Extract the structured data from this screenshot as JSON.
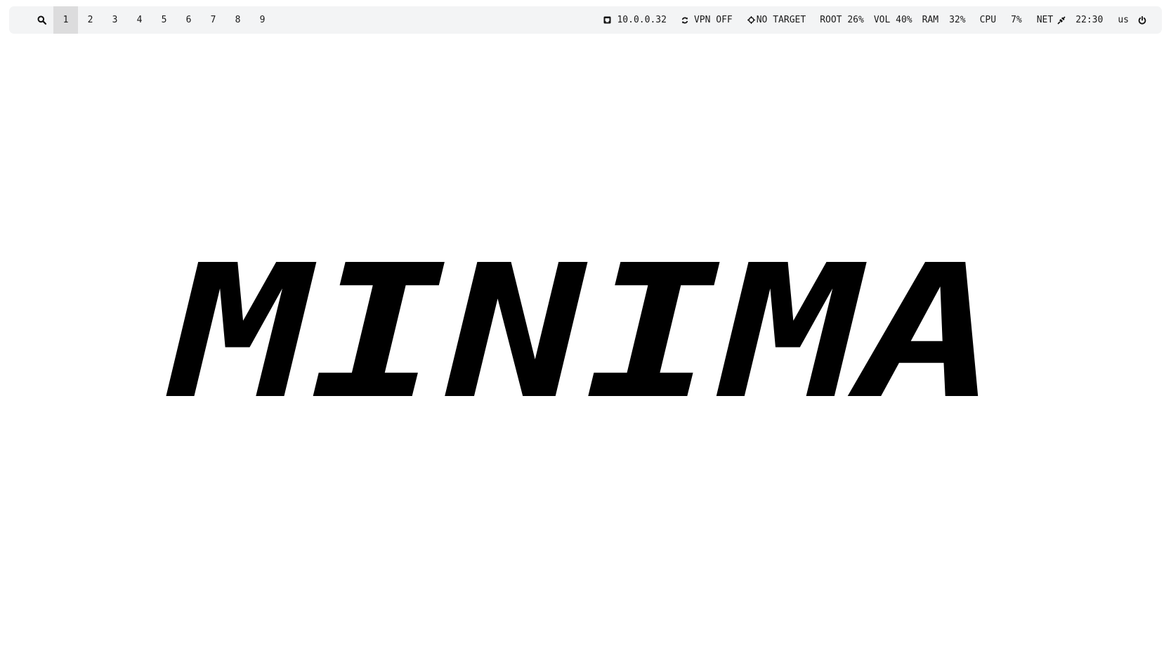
{
  "topbar": {
    "workspaces": [
      "1",
      "2",
      "3",
      "4",
      "5",
      "6",
      "7",
      "8",
      "9"
    ],
    "active_workspace": "1",
    "ip": {
      "icon": "ethernet-icon",
      "text": "10.0.0.32"
    },
    "vpn": {
      "icon": "sync-icon",
      "text": "VPN OFF"
    },
    "target": {
      "icon": "crosshair-icon",
      "text": "NO TARGET"
    },
    "root": "ROOT 26%",
    "vol": "VOL 40%",
    "ram_label": "RAM",
    "ram_value": "32%",
    "cpu_label": "CPU",
    "cpu_value": "7%",
    "net_label": "NET",
    "net_icon": "plug-icon",
    "clock": "22:30",
    "layout": "us",
    "power_icon": "power-icon"
  },
  "hero": {
    "text": "MINIMA"
  },
  "colors": {
    "bar_background": "#f3f4f5",
    "active_workspace": "#dcdcdd",
    "text": "#1a1a1a",
    "hero": "#000000"
  }
}
